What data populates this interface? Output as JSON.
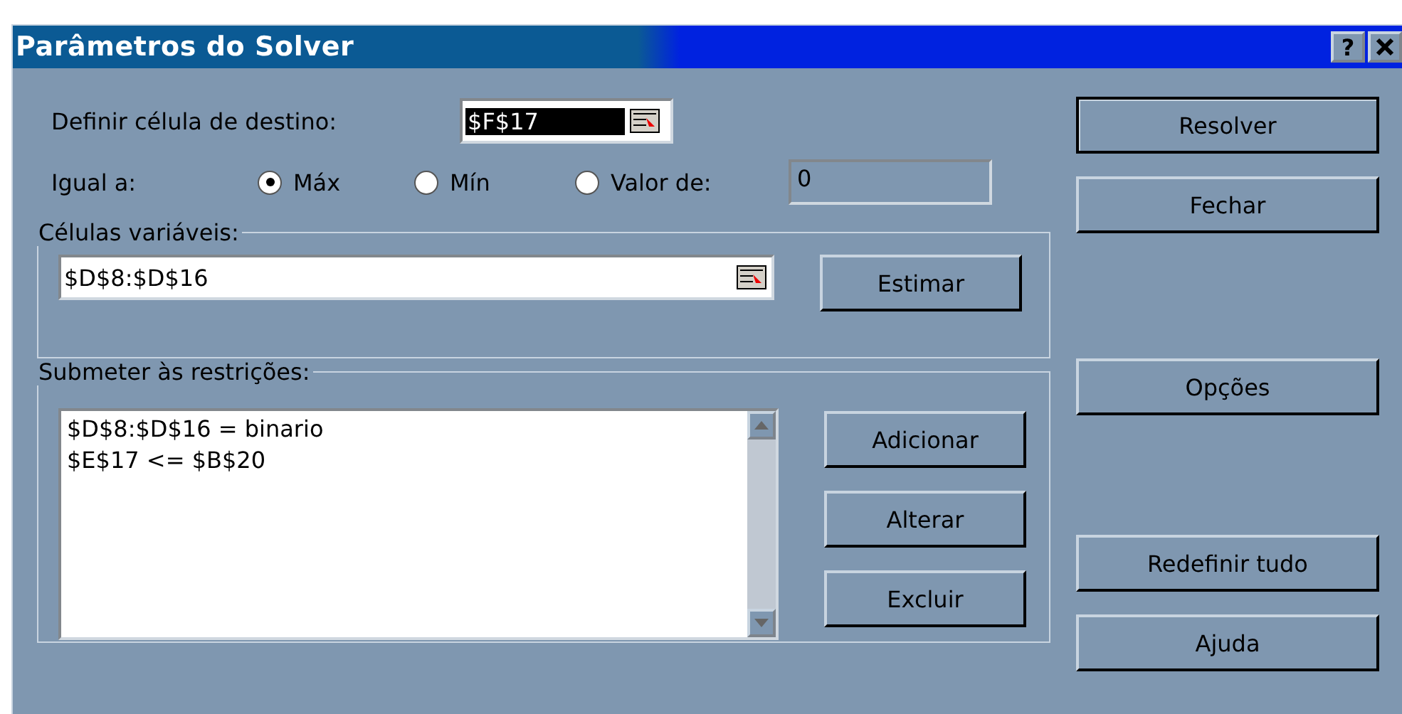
{
  "window": {
    "title": "Parâmetros do Solver",
    "help_button": "?"
  },
  "target": {
    "label": "Definir célula de destino:",
    "value": "$F$17",
    "text_selected": true
  },
  "equal_to": {
    "label": "Igual a:",
    "options": [
      {
        "label": "Máx",
        "selected": true
      },
      {
        "label": "Mín",
        "selected": false
      },
      {
        "label": "Valor de:",
        "selected": false
      }
    ],
    "value_field": {
      "value": "0",
      "disabled": true
    }
  },
  "variable_cells": {
    "title": "Células variáveis:",
    "value": "$D$8:$D$16",
    "button": "Estimar"
  },
  "constraints": {
    "title": "Submeter às restrições:",
    "items": [
      "$D$8:$D$16 = binario",
      "$E$17 <= $B$20"
    ],
    "buttons": [
      "Adicionar",
      "Alterar",
      "Excluir"
    ]
  },
  "side_buttons": [
    {
      "label": "Resolver",
      "default": true
    },
    {
      "label": "Fechar",
      "default": false
    },
    {
      "label": "Opções",
      "default": false
    },
    {
      "label": "Redefinir tudo",
      "default": false
    },
    {
      "label": "Ajuda",
      "default": false
    }
  ]
}
